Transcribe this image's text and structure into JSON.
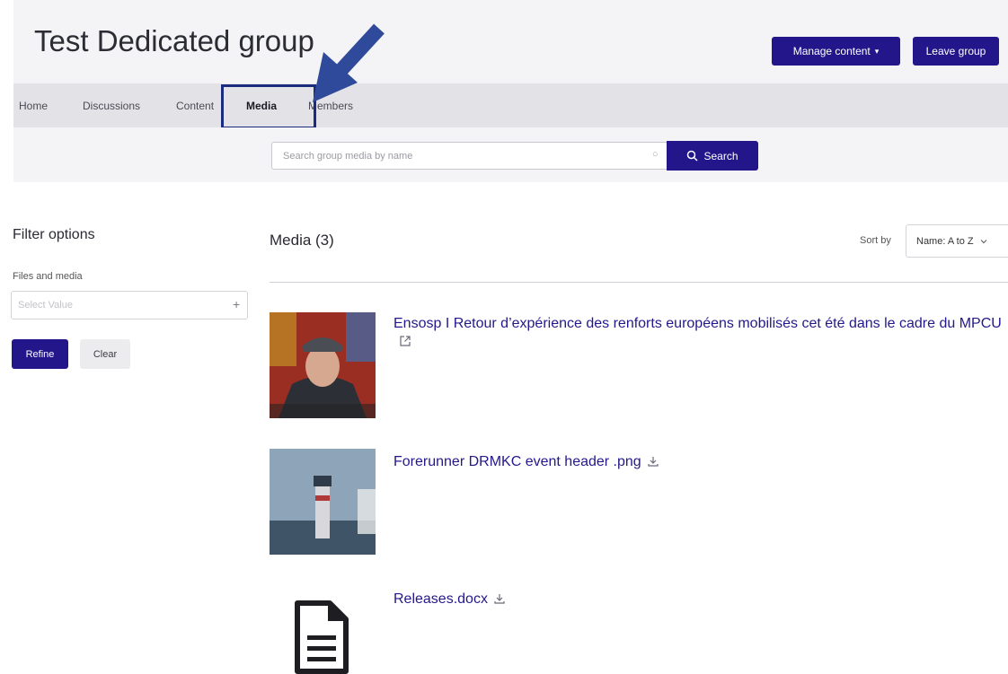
{
  "header": {
    "title": "Test Dedicated group",
    "manage_content_label": "Manage content",
    "manage_content_caret": "▾",
    "leave_group_label": "Leave group"
  },
  "tabs": [
    {
      "label": "Home"
    },
    {
      "label": "Discussions"
    },
    {
      "label": "Content"
    },
    {
      "label": "Media",
      "active": true
    },
    {
      "label": "Members"
    }
  ],
  "search": {
    "placeholder": "Search group media by name",
    "button_label": "Search"
  },
  "filters": {
    "title": "Filter options",
    "files_label": "Files and media",
    "select_placeholder": "Select Value",
    "refine_label": "Refine",
    "clear_label": "Clear"
  },
  "media": {
    "heading": "Media (3)",
    "sort_label": "Sort by",
    "sort_value": "Name: A to Z",
    "items": [
      {
        "title": "Ensosp I Retour d’expérience des renforts européens mobilisés cet été dans le cadre du MPCU",
        "type": "external-link"
      },
      {
        "title": "Forerunner DRMKC event header .png",
        "type": "download"
      },
      {
        "title": "Releases.docx",
        "type": "download"
      }
    ]
  },
  "colors": {
    "accent": "#22168a",
    "link": "#23188a",
    "annotation": "#1a2c80"
  },
  "icons": [
    "search-icon",
    "external-link-icon",
    "download-icon",
    "document-icon",
    "plus-icon",
    "chevron-down-icon",
    "clear-search-icon"
  ]
}
